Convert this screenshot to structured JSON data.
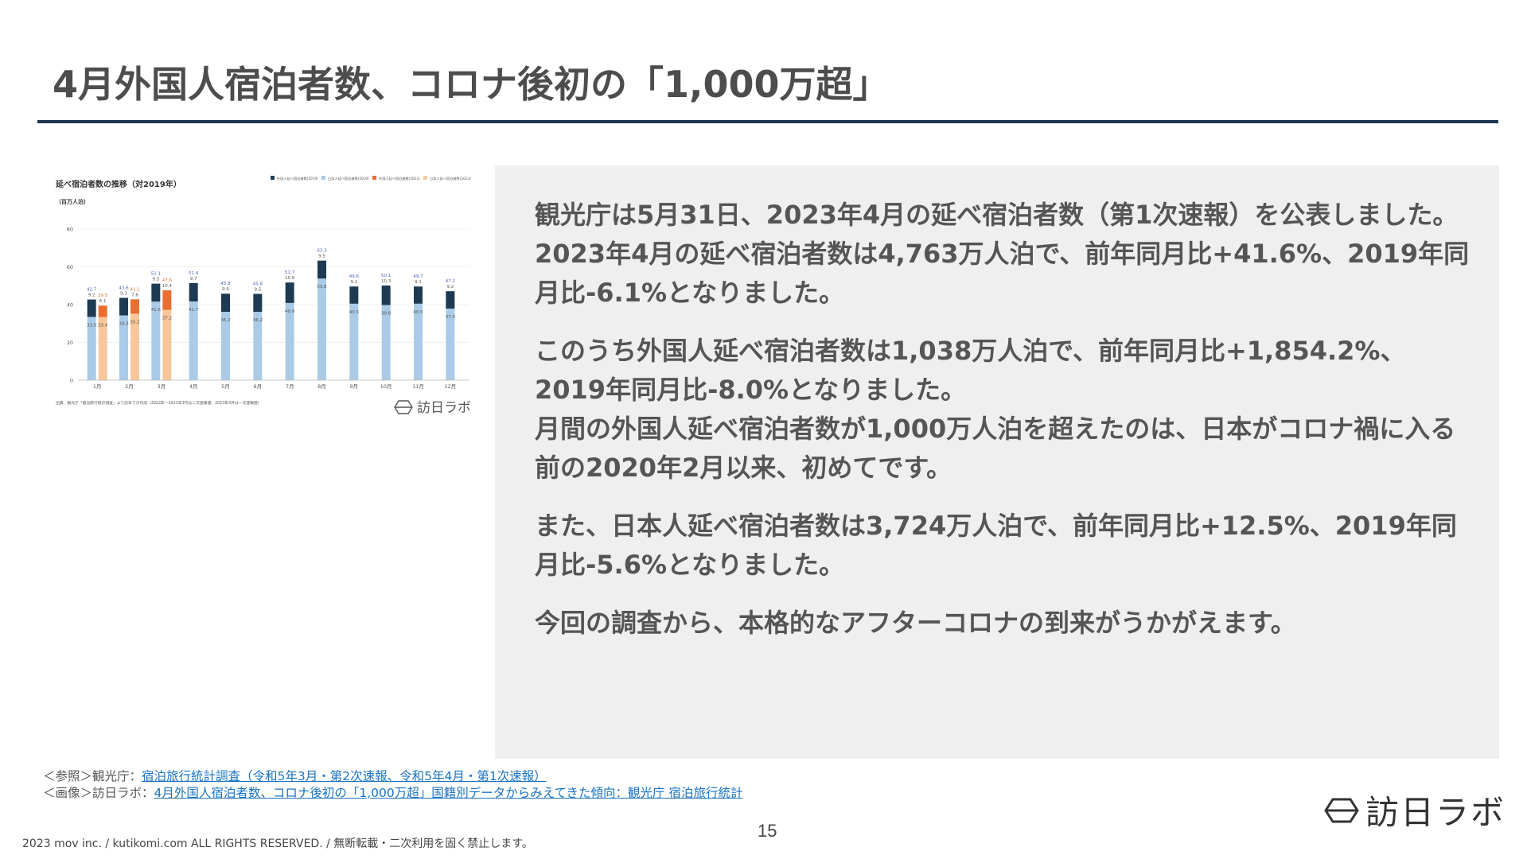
{
  "slide": {
    "title": "4月外国人宿泊者数、コロナ後初の「1,000万超」",
    "page_number": "15",
    "copyright": "2023 mov inc. / kutikomi.com ALL RIGHTS RESERVED. / 無断転載・二次利用を固く禁止します。"
  },
  "body": {
    "paragraphs": [
      "観光庁は5月31日、2023年4月の延べ宿泊者数（第1次速報）を公表しました。\n2023年4月の延べ宿泊者数は4,763万人泊で、前年同月比+41.6%、2019年同月比-6.1%となりました。",
      "このうち外国人延べ宿泊者数は1,038万人泊で、前年同月比+1,854.2%、2019年同月比-8.0%となりました。\n月間の外国人延べ宿泊者数が1,000万人泊を超えたのは、日本がコロナ禍に入る前の2020年2月以来、初めてです。",
      "また、日本人延べ宿泊者数は3,724万人泊で、前年同月比+12.5%、2019年同月比-5.6%となりました。",
      "今回の調査から、本格的なアフターコロナの到来がうかがえます。"
    ]
  },
  "references": {
    "line1_prefix": "＜参照＞観光庁：",
    "line1_link": "宿泊旅行統計調査（令和5年3月・第2次速報、令和5年4月・第1次速報）",
    "line2_prefix": "＜画像＞訪日ラボ：",
    "line2_link": "4月外国人宿泊者数、コロナ後初の「1,000万超」国籍別データからみえてきた傾向：観光庁 宿泊旅行統計"
  },
  "brand": {
    "name": "訪日ラボ",
    "icon": "hexagon-logo-icon"
  },
  "chart_data": {
    "type": "bar",
    "title": "延べ宿泊者数の推移（対2019年）",
    "ylabel": "（百万人泊）",
    "ylim": [
      0,
      80
    ],
    "yticks": [
      0,
      20,
      40,
      60,
      80
    ],
    "categories": [
      "1月",
      "2月",
      "3月",
      "4月",
      "5月",
      "6月",
      "7月",
      "8月",
      "9月",
      "10月",
      "11月",
      "12月"
    ],
    "legend_position": "top-right",
    "series": [
      {
        "name": "外国人延べ宿泊者数(2019)",
        "color": "#1d3a52",
        "values": [
          9.2,
          9.3,
          9.5,
          9.7,
          9.6,
          9.5,
          10.8,
          9.5,
          9.1,
          10.3,
          9.1,
          9.2
        ]
      },
      {
        "name": "日本人延べ宿泊者数(2019)",
        "color": "#a9cbe8",
        "values": [
          33.5,
          34.3,
          41.6,
          41.7,
          36.2,
          36.2,
          40.9,
          53.8,
          40.5,
          39.8,
          40.5,
          37.9
        ]
      },
      {
        "name": "外国人延べ宿泊者数(2023)",
        "color": "#e96e32",
        "values": [
          6.1,
          7.6,
          10.4
        ]
      },
      {
        "name": "日本人延べ宿泊者数(2023)",
        "color": "#f7c79b",
        "values": [
          33.4,
          35.2,
          37.2
        ]
      }
    ],
    "totals_2019": [
      42.7,
      43.6,
      51.1,
      51.4,
      45.8,
      45.8,
      51.7,
      63.3,
      49.6,
      50.1,
      49.7,
      47.1
    ],
    "totals_2023": [
      39.5,
      41.1,
      47.6
    ],
    "source_note": "出典：観光庁「宿泊旅行統計調査」より訪日ラボ作成（2022年〜2023年3月は二次速報値、2023年3月は一次速報値）"
  }
}
